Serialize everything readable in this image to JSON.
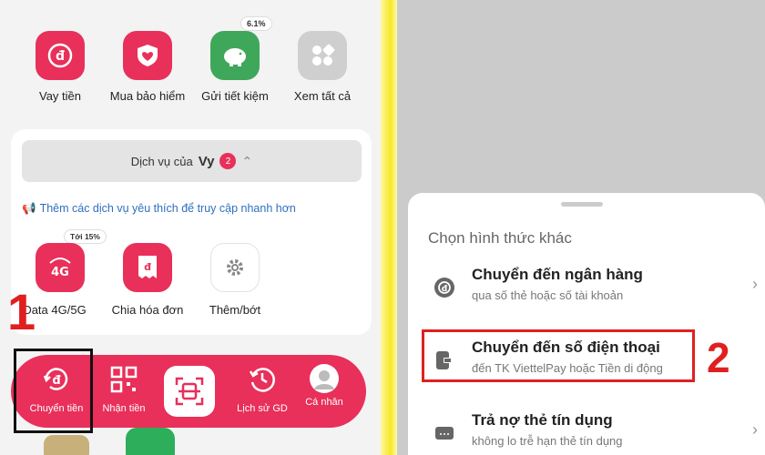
{
  "quick_actions": [
    {
      "label": "Vay tiền",
      "icon": "loan-icon",
      "color": "#e8305a"
    },
    {
      "label": "Mua bảo hiểm",
      "icon": "insurance-shield-icon",
      "color": "#e8305a"
    },
    {
      "label": "Gửi tiết kiệm",
      "icon": "piggy-bank-icon",
      "color": "#3fa75a"
    },
    {
      "label": "Xem tất cả",
      "icon": "grid-icon",
      "color": "#cfcfcf"
    }
  ],
  "savings_rate_badge": "6.1%",
  "services": {
    "header_prefix": "Dịch vụ của",
    "user_name": "Vy",
    "count": "2",
    "hint": "Thêm các dịch vụ yêu thích để truy cập nhanh hơn",
    "promo_badge": "Tới 15%",
    "items": [
      {
        "label": "Data 4G/5G",
        "icon": "4g-data-icon"
      },
      {
        "label": "Chia hóa đơn",
        "icon": "split-bill-icon"
      },
      {
        "label": "Thêm/bớt",
        "icon": "settings-gear-icon"
      }
    ]
  },
  "tabbar": {
    "items": [
      {
        "label": "Chuyển tiền",
        "icon": "transfer-money-icon"
      },
      {
        "label": "Nhận tiền",
        "icon": "qr-receive-icon"
      },
      {
        "label": "",
        "icon": "scan-qr-icon"
      },
      {
        "label": "Lịch sử GD",
        "icon": "history-clock-icon"
      },
      {
        "label": "Cá nhân",
        "icon": "profile-avatar-icon"
      }
    ],
    "accent": "#e8305a"
  },
  "step_markers": {
    "one": "1",
    "two": "2"
  },
  "sheet": {
    "title": "Chọn hình thức khác",
    "options": [
      {
        "title": "Chuyển đến ngân hàng",
        "subtitle": "qua số thẻ hoặc số tài khoản",
        "icon": "bank-transfer-icon"
      },
      {
        "title": "Chuyển đến số điện thoại",
        "subtitle": "đến TK ViettelPay hoặc Tiền di động",
        "icon": "phone-transfer-icon"
      },
      {
        "title": "Trả nợ thẻ tín dụng",
        "subtitle": "không lo trễ hạn thẻ tín dụng",
        "icon": "credit-card-icon"
      }
    ]
  }
}
